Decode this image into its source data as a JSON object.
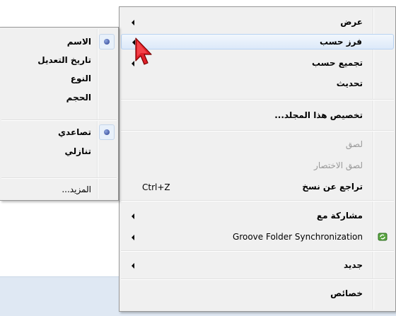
{
  "colors": {
    "menu_bg": "#f0f0f0",
    "hover_border": "#b9d3f2",
    "disabled_text": "#9a9a9a",
    "radio_dot": "#2a3f8f",
    "cursor_fill": "#e0202a"
  },
  "menu": {
    "items": [
      {
        "label": "عرض",
        "submenu": true
      },
      {
        "label": "فرز حسب",
        "submenu": true,
        "hover": true
      },
      {
        "label": "تجميع حسب",
        "submenu": true
      },
      {
        "label": "تحديث"
      },
      {
        "label": "تخصيص هذا المجلد..."
      },
      {
        "label": "لصق",
        "disabled": true
      },
      {
        "label": "لصق الاختصار",
        "disabled": true
      },
      {
        "label": "تراجع عن نسخ",
        "shortcut": "Ctrl+Z"
      },
      {
        "label": "مشاركة مع",
        "submenu": true
      },
      {
        "label": "Groove Folder Synchronization",
        "submenu": true,
        "icon": "groove-sync-icon"
      },
      {
        "label": "جديد",
        "submenu": true
      },
      {
        "label": "خصائص"
      }
    ]
  },
  "submenu": {
    "items": [
      {
        "label": "الاسم",
        "radio": true
      },
      {
        "label": "تاريخ التعديل"
      },
      {
        "label": "النوع"
      },
      {
        "label": "الحجم"
      },
      {
        "label": "تصاعدي",
        "radio": true
      },
      {
        "label": "تنازلي"
      },
      {
        "label": "المزيد..."
      }
    ]
  }
}
